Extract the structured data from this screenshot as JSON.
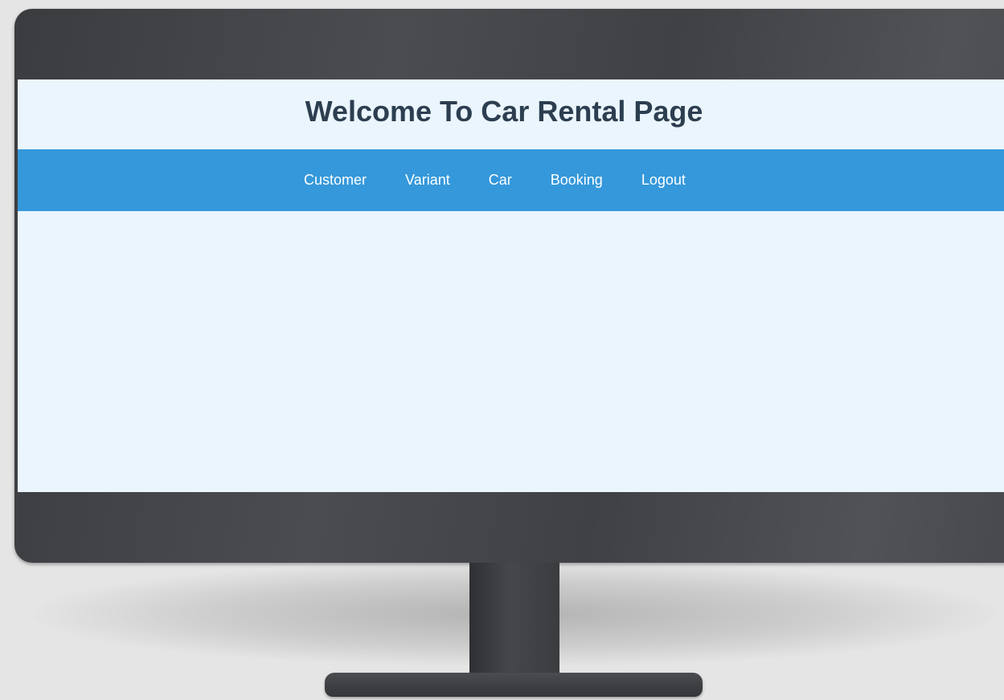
{
  "page": {
    "title": "Welcome To Car Rental Page"
  },
  "nav": {
    "items": [
      {
        "label": "Customer"
      },
      {
        "label": "Variant"
      },
      {
        "label": "Car"
      },
      {
        "label": "Booking"
      },
      {
        "label": "Logout"
      }
    ]
  },
  "colors": {
    "header_bg": "#eaf5fd",
    "nav_bg": "#3498db",
    "title_text": "#2c3e50",
    "nav_text": "#ffffff",
    "monitor_bezel": "#424448"
  }
}
